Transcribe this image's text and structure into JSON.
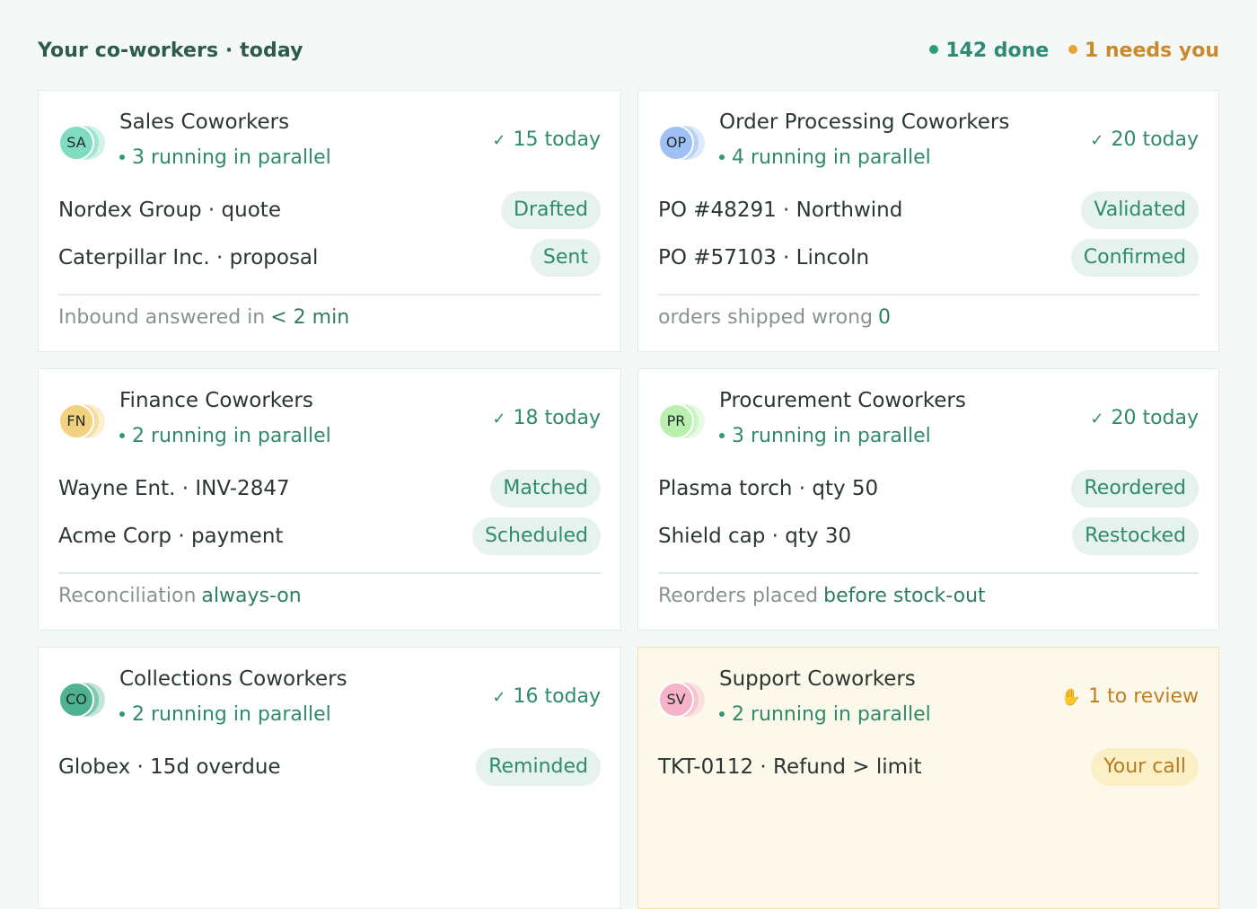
{
  "header": {
    "title": "Your co-workers · today",
    "done_text": "142 done",
    "needs_text": "1 needs you"
  },
  "colors": {
    "accent_green": "#2e8a73",
    "accent_amber": "#c88a2c"
  },
  "cards": [
    {
      "initials": "SA",
      "avatar_color": "#7fdcc0",
      "title": "Sales Coworkers",
      "subtitle": "3 running in parallel",
      "count_icon": "check-icon",
      "count_symbol": "✓",
      "count": "15 today",
      "rows": [
        {
          "label": "Nordex Group · quote",
          "status": "Drafted"
        },
        {
          "label": "Caterpillar Inc. · proposal",
          "status": "Sent"
        }
      ],
      "footer_label": "Inbound answered in",
      "footer_value": "< 2 min"
    },
    {
      "initials": "OP",
      "avatar_color": "#9fc0f5",
      "title": "Order Processing Coworkers",
      "subtitle": "4 running in parallel",
      "count_icon": "check-icon",
      "count_symbol": "✓",
      "count": "20 today",
      "rows": [
        {
          "label": "PO #48291 · Northwind",
          "status": "Validated"
        },
        {
          "label": "PO #57103 · Lincoln",
          "status": "Confirmed"
        }
      ],
      "footer_label": "orders shipped wrong",
      "footer_value": "0"
    },
    {
      "initials": "FN",
      "avatar_color": "#f2d27e",
      "title": "Finance Coworkers",
      "subtitle": "2 running in parallel",
      "count_icon": "check-icon",
      "count_symbol": "✓",
      "count": "18 today",
      "rows": [
        {
          "label": "Wayne Ent. · INV-2847",
          "status": "Matched"
        },
        {
          "label": "Acme Corp · payment",
          "status": "Scheduled"
        }
      ],
      "footer_label": "Reconciliation",
      "footer_value": "always-on"
    },
    {
      "initials": "PR",
      "avatar_color": "#b9f0b0",
      "title": "Procurement Coworkers",
      "subtitle": "3 running in parallel",
      "count_icon": "check-icon",
      "count_symbol": "✓",
      "count": "20 today",
      "rows": [
        {
          "label": "Plasma torch · qty 50",
          "status": "Reordered"
        },
        {
          "label": "Shield cap · qty 30",
          "status": "Restocked"
        }
      ],
      "footer_label": "Reorders placed",
      "footer_value": "before stock-out"
    },
    {
      "initials": "CO",
      "avatar_color": "#4fb393",
      "title": "Collections Coworkers",
      "subtitle": "2 running in parallel",
      "count_icon": "check-icon",
      "count_symbol": "✓",
      "count": "16 today",
      "rows": [
        {
          "label": "Globex · 15d overdue",
          "status": "Reminded"
        }
      ],
      "footer_label": "",
      "footer_value": ""
    },
    {
      "initials": "SV",
      "avatar_color": "#f6b3c7",
      "title": "Support Coworkers",
      "subtitle": "2 running in parallel",
      "count_icon": "hand-icon",
      "count_symbol": "✋",
      "count": "1 to review",
      "rows": [
        {
          "label": "TKT-0112 · Refund > limit",
          "status": "Your call"
        }
      ],
      "footer_label": "",
      "footer_value": "",
      "needs_review": true
    }
  ]
}
